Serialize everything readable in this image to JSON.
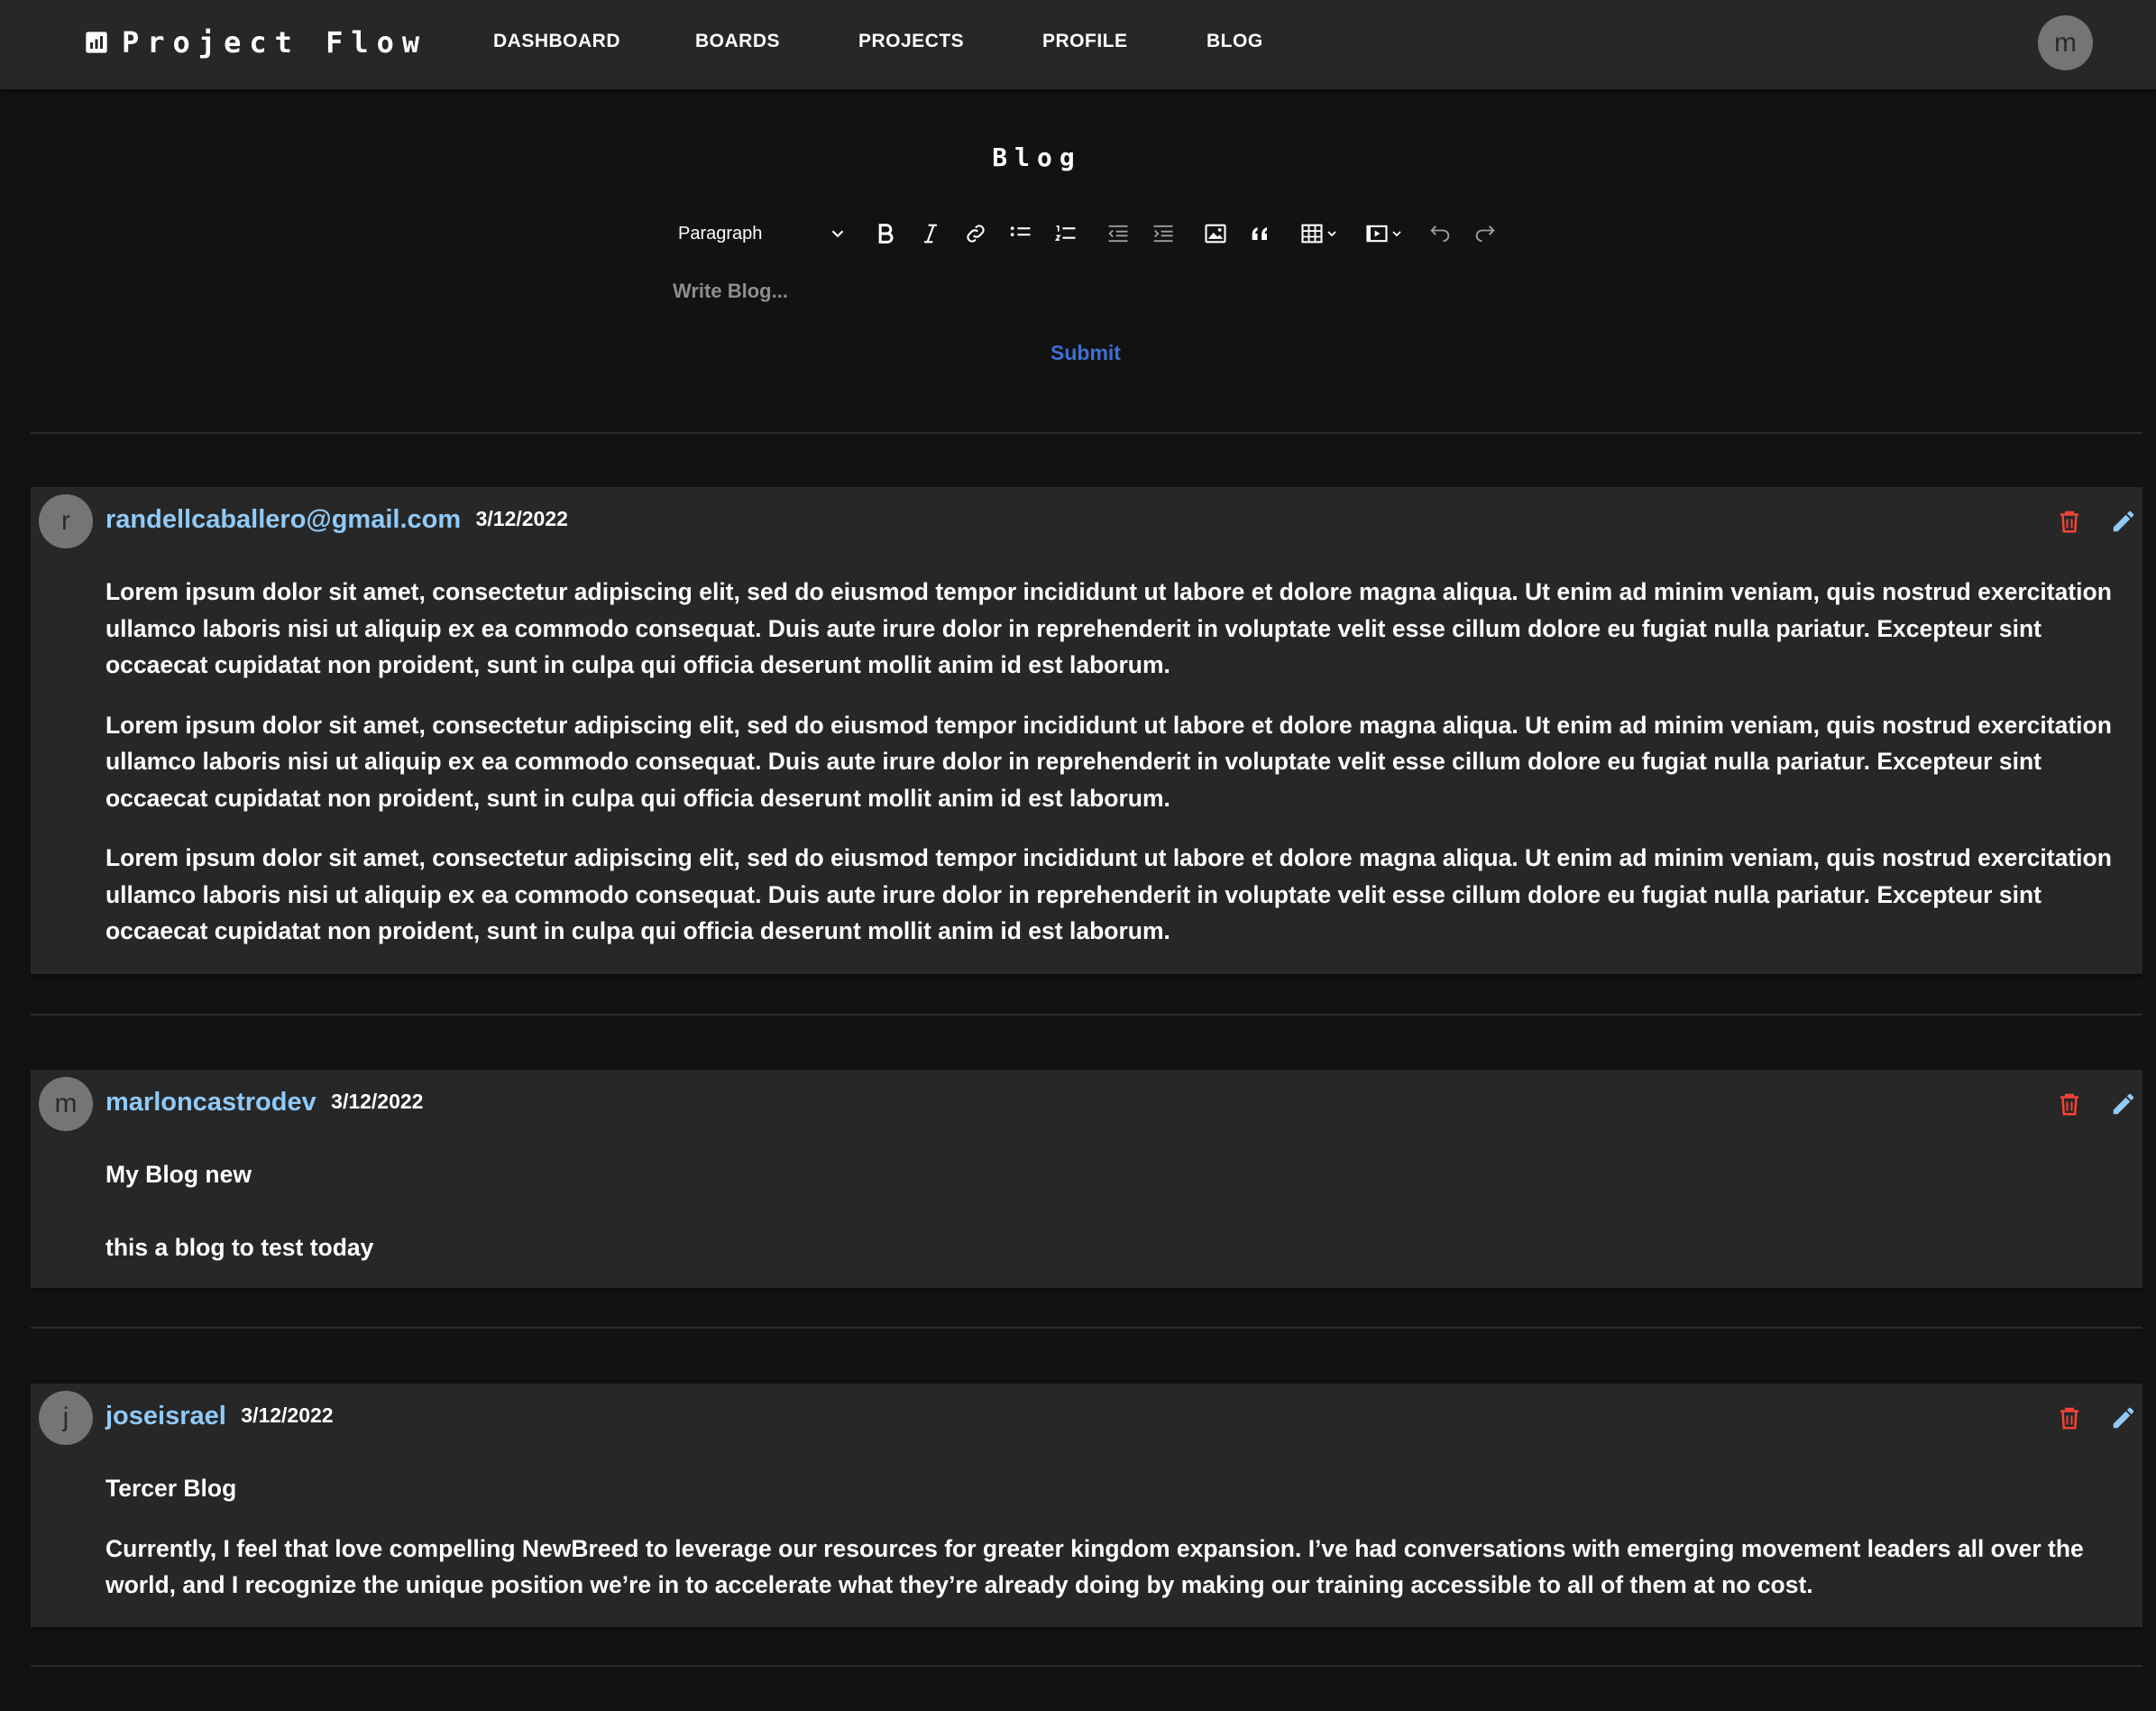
{
  "brand": {
    "title": "Project Flow",
    "icon": "bar-chart-icon"
  },
  "nav": {
    "items": [
      "DASHBOARD",
      "BOARDS",
      "PROJECTS",
      "PROFILE",
      "BLOG"
    ],
    "avatar_letter": "m"
  },
  "editor": {
    "title": "Blog",
    "block_format": "Paragraph",
    "toolbar_icons": [
      "bold-icon",
      "italic-icon",
      "link-icon",
      "bulleted-list-icon",
      "numbered-list-icon",
      "outdent-icon",
      "indent-icon",
      "image-icon",
      "quote-icon",
      "table-icon",
      "media-icon",
      "undo-icon",
      "redo-icon"
    ],
    "placeholder": "Write Blog...",
    "submit_label": "Submit"
  },
  "colors": {
    "background": "#121212",
    "surface": "#272727",
    "author": "#90caf9",
    "delete": "#f44336",
    "edit": "#90caf9",
    "submit": "#3f6fd6"
  },
  "posts": [
    {
      "avatar_letter": "r",
      "author": "randellcaballero@gmail.com",
      "date": "3/12/2022",
      "paragraphs": [
        "Lorem ipsum dolor sit amet, consectetur adipiscing elit, sed do eiusmod tempor incididunt ut labore et dolore magna aliqua. Ut enim ad minim veniam, quis nostrud exercitation ullamco laboris nisi ut aliquip ex ea commodo consequat. Duis aute irure dolor in reprehenderit in voluptate velit esse cillum dolore eu fugiat nulla pariatur. Excepteur sint occaecat cupidatat non proident, sunt in culpa qui officia deserunt mollit anim id est laborum.",
        "Lorem ipsum dolor sit amet, consectetur adipiscing elit, sed do eiusmod tempor incididunt ut labore et dolore magna aliqua. Ut enim ad minim veniam, quis nostrud exercitation ullamco laboris nisi ut aliquip ex ea commodo consequat. Duis aute irure dolor in reprehenderit in voluptate velit esse cillum dolore eu fugiat nulla pariatur. Excepteur sint occaecat cupidatat non proident, sunt in culpa qui officia deserunt mollit anim id est laborum.",
        "Lorem ipsum dolor sit amet, consectetur adipiscing elit, sed do eiusmod tempor incididunt ut labore et dolore magna aliqua. Ut enim ad minim veniam, quis nostrud exercitation ullamco laboris nisi ut aliquip ex ea commodo consequat. Duis aute irure dolor in reprehenderit in voluptate velit esse cillum dolore eu fugiat nulla pariatur. Excepteur sint occaecat cupidatat non proident, sunt in culpa qui officia deserunt mollit anim id est laborum."
      ]
    },
    {
      "avatar_letter": "m",
      "author": "marloncastrodev",
      "date": "3/12/2022",
      "paragraphs": [
        "My Blog new",
        "this a blog to test today"
      ]
    },
    {
      "avatar_letter": "j",
      "author": "joseisrael",
      "date": "3/12/2022",
      "paragraphs": [
        "Tercer Blog",
        "Currently, I feel that love compelling NewBreed to leverage our resources for greater kingdom expansion. I’ve had conversations with emerging movement leaders all over the world, and I recognize the unique position we’re in to accelerate what they’re already doing by making our training accessible to all of them at no cost."
      ]
    }
  ]
}
